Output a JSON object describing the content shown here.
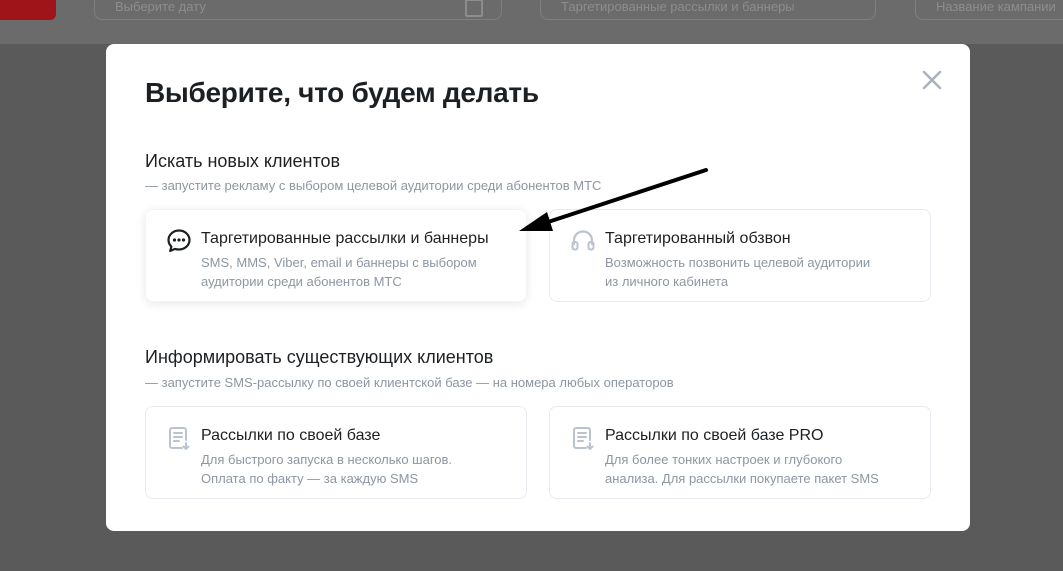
{
  "background_fields": {
    "field1_text": "Выберите дату",
    "field2_text": "Таргетированные рассылки и баннеры",
    "field3_text": "Название кампании"
  },
  "modal": {
    "title": "Выберите, что будем делать",
    "close_icon": "close-icon",
    "sections": [
      {
        "title": "Искать новых клиентов",
        "subtitle": "— запустите рекламу с выбором целевой аудитории среди абонентов МТС",
        "cards": [
          {
            "icon": "chat-bubble-icon",
            "title": "Таргетированные рассылки и баннеры",
            "desc_line1": "SMS, MMS, Viber, email и баннеры с выбором",
            "desc_line2": "аудитории среди абонентов МТС"
          },
          {
            "icon": "headset-icon",
            "title": "Таргетированный обзвон",
            "desc_line1": "Возможность позвонить целевой аудитории",
            "desc_line2": "из личного кабинета"
          }
        ]
      },
      {
        "title": "Информировать существующих клиентов",
        "subtitle": "— запустите SMS-рассылку по своей клиентской базе — на номера любых операторов",
        "cards": [
          {
            "icon": "document-list-icon",
            "title": "Рассылки по своей базе",
            "desc_line1": "Для быстрого запуска в несколько шагов.",
            "desc_line2": "Оплата по факту — за каждую SMS"
          },
          {
            "icon": "document-list-icon",
            "title": "Рассылки по своей базе PRO",
            "desc_line1": "Для более тонких настроек и глубокого",
            "desc_line2": "анализа. Для рассылки покупаете пакет SMS"
          }
        ]
      }
    ]
  },
  "annotation": {
    "icon": "pointer-arrow-icon",
    "color": "#000000"
  },
  "colors": {
    "overlay": "#5a5a5a",
    "text_primary": "#1d2023",
    "text_secondary": "#8d96a3",
    "icon_muted": "#bcc3d0",
    "card_border": "#e7ebf0"
  }
}
